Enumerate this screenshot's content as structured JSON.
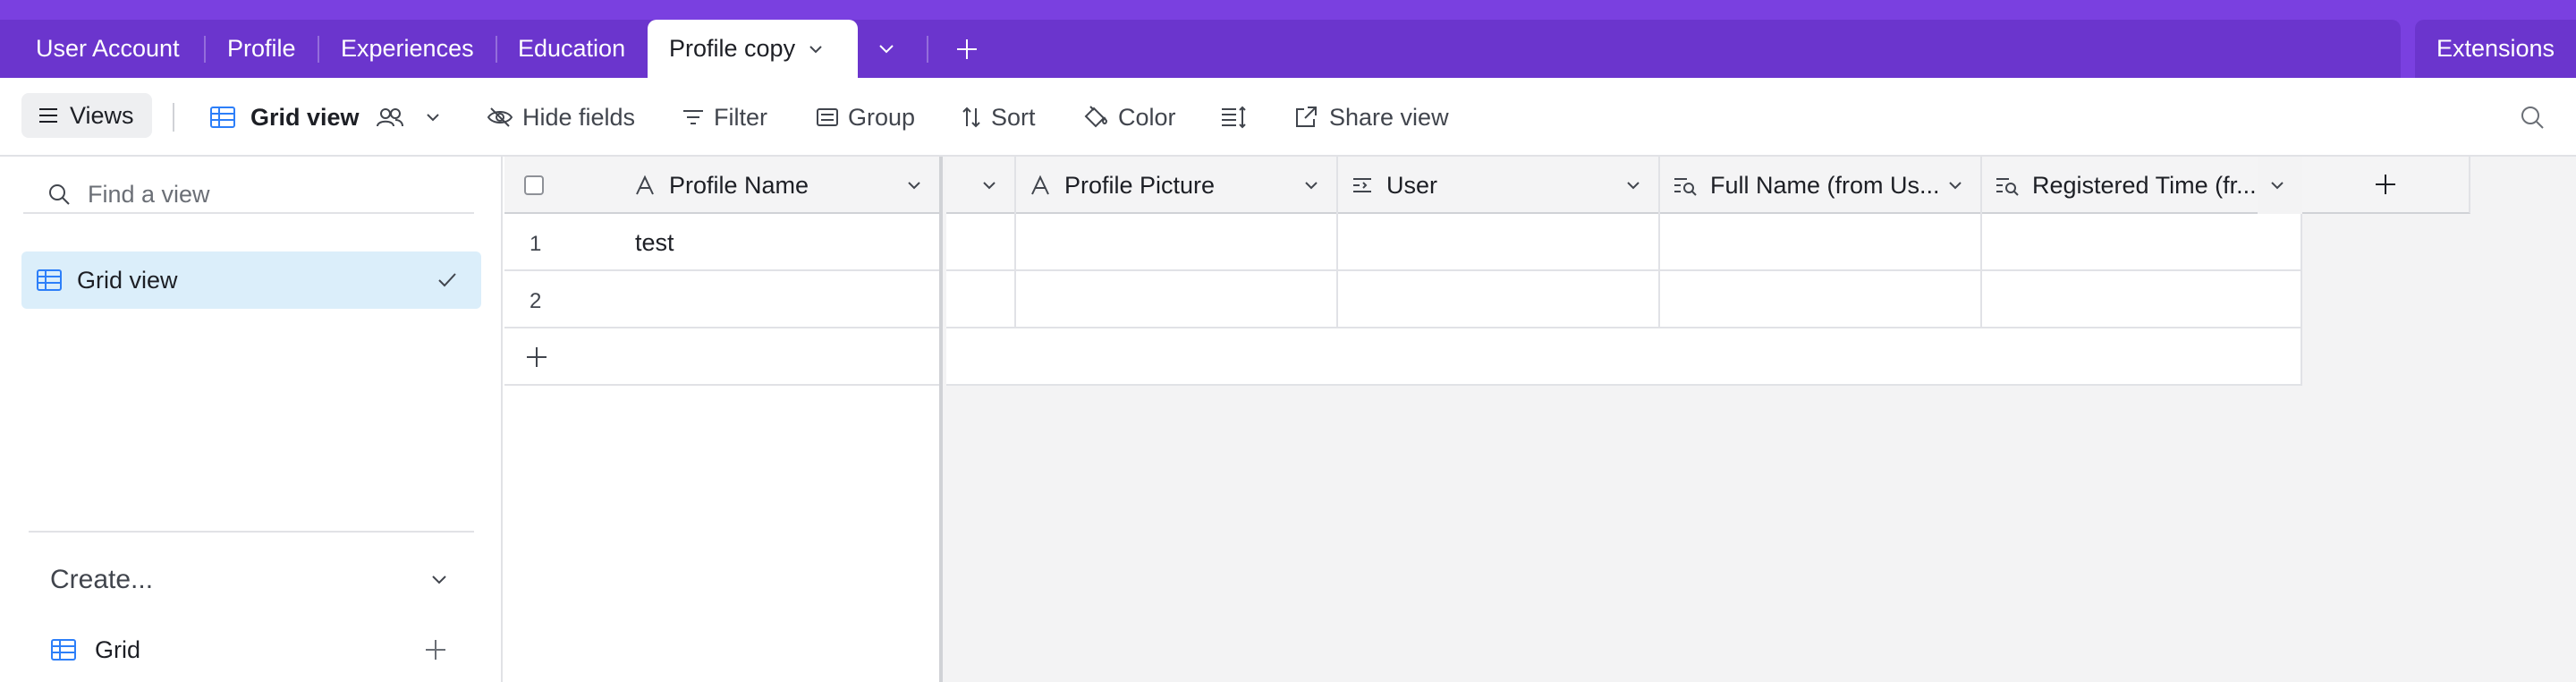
{
  "tabs": {
    "items": [
      {
        "label": "User Account"
      },
      {
        "label": "Profile"
      },
      {
        "label": "Experiences"
      },
      {
        "label": "Education"
      }
    ],
    "active": {
      "label": "Profile copy"
    },
    "extensions_label": "Extensions"
  },
  "toolbar": {
    "views_label": "Views",
    "grid_view_label": "Grid view",
    "hide_fields_label": "Hide fields",
    "filter_label": "Filter",
    "group_label": "Group",
    "sort_label": "Sort",
    "color_label": "Color",
    "share_view_label": "Share view"
  },
  "sidebar": {
    "search_placeholder": "Find a view",
    "views": [
      {
        "label": "Grid view",
        "selected": true
      }
    ],
    "create_label": "Create...",
    "create_items": [
      {
        "label": "Grid"
      }
    ]
  },
  "grid": {
    "frozen_column": "Profile Name",
    "columns": [
      {
        "label": "Profile Picture",
        "icon": "long-text-icon"
      },
      {
        "label": "User",
        "icon": "linked-record-icon"
      },
      {
        "label": "Full Name (from Us...",
        "icon": "lookup-icon"
      },
      {
        "label": "Registered Time (fr...",
        "icon": "lookup-icon"
      }
    ],
    "rows": [
      {
        "num": "1",
        "profile_name": "test"
      },
      {
        "num": "2",
        "profile_name": ""
      }
    ]
  },
  "colors": {
    "accent_purple": "#7a40e0",
    "tab_strip": "#6b35cd",
    "selected_view_bg": "#dbeefa",
    "grid_blue": "#2d7ff9"
  }
}
